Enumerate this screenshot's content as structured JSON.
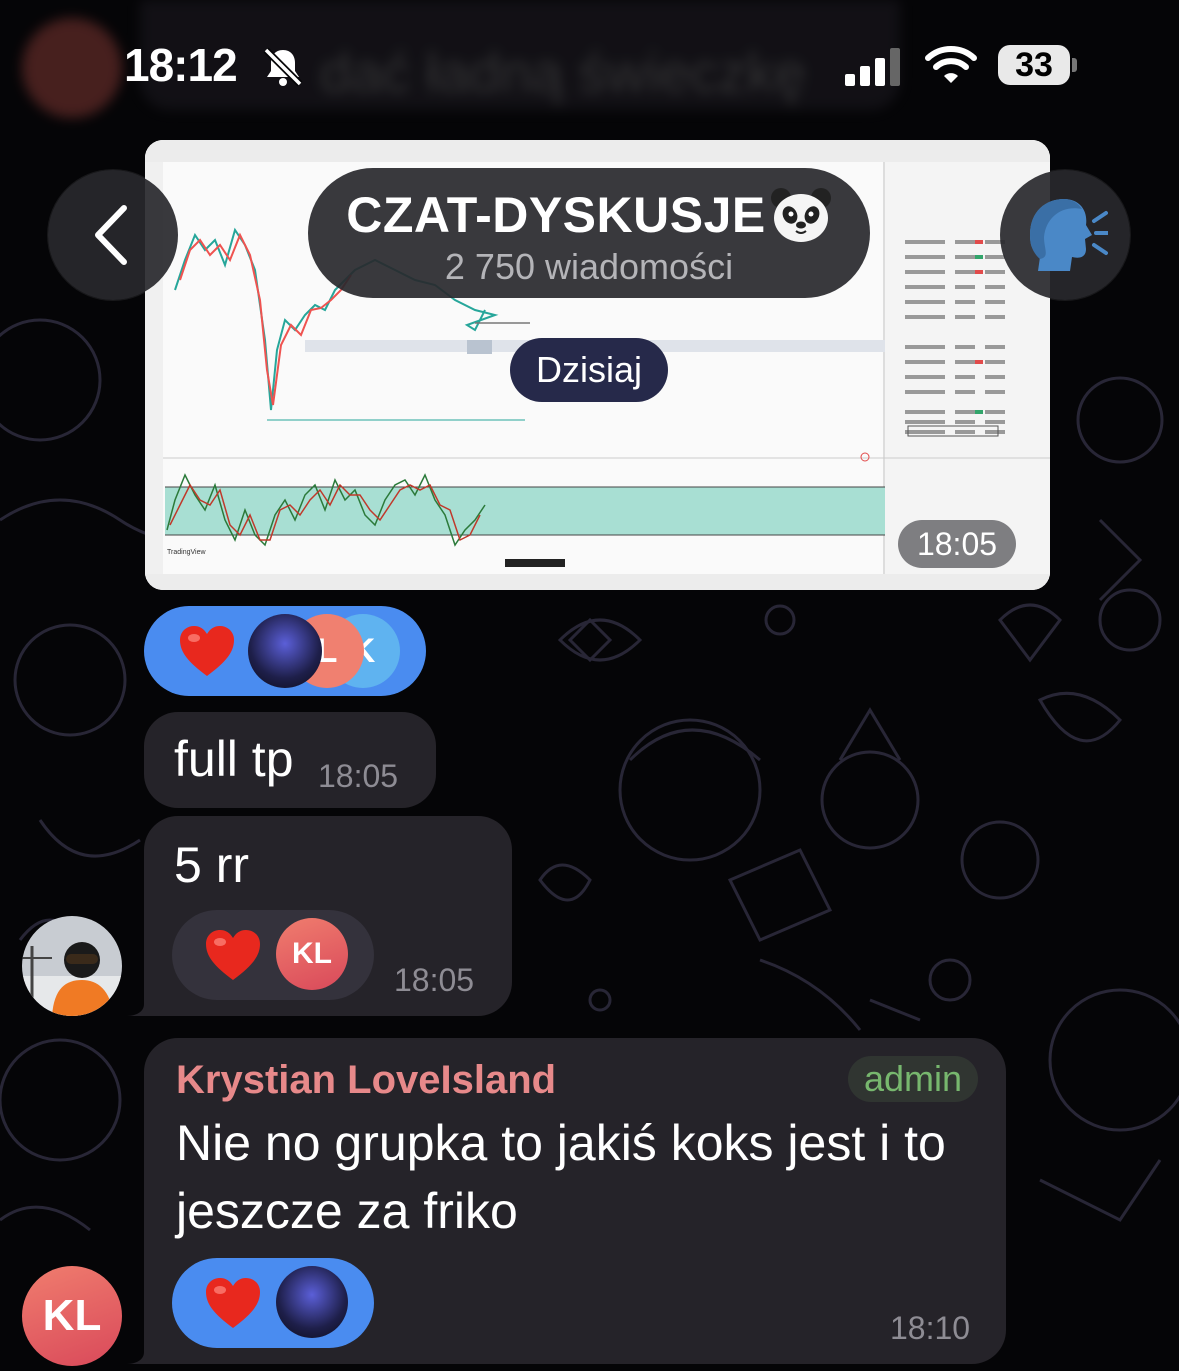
{
  "status_bar": {
    "time": "18:12",
    "battery": "33"
  },
  "header": {
    "title": "CZAT-DYSKUSJE",
    "subtitle": "2 750 wiadomości"
  },
  "blurred_prev": {
    "avatar_initials": "KL",
    "text": "dać ładną świeczkę"
  },
  "date_separator": "Dzisiaj",
  "messages": [
    {
      "type": "image",
      "time": "18:05",
      "reactions": {
        "emoji": "heart",
        "avatars": [
          "photo",
          "L",
          "K"
        ]
      }
    },
    {
      "type": "text",
      "text": "full tp",
      "time": "18:05"
    },
    {
      "type": "text",
      "text": "5 rr",
      "time": "18:05",
      "reactions": {
        "emoji": "heart",
        "avatars": [
          "KL"
        ]
      }
    },
    {
      "type": "text",
      "sender": "Krystian LoveIsland",
      "role": "admin",
      "lines": [
        "Nie no grupka to jakiś koks jest i to",
        "jeszcze za friko"
      ],
      "time": "18:10",
      "reactions": {
        "emoji": "heart",
        "avatars": [
          "photo"
        ]
      },
      "avatar_initials": "KL"
    }
  ],
  "colors": {
    "sender_name": "#e7898a",
    "admin": "#77b76e",
    "reaction_blue": "#4a8cf0",
    "bubble": "#252329"
  }
}
